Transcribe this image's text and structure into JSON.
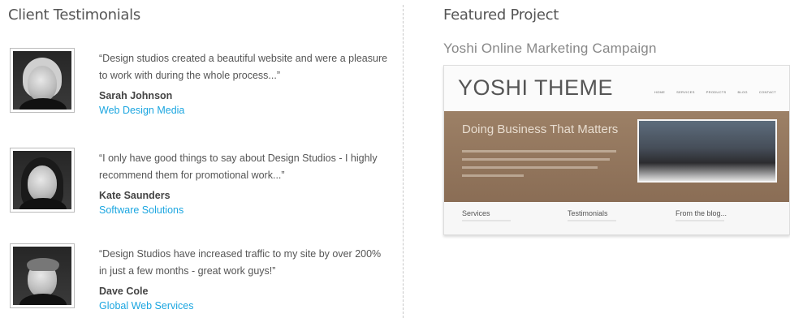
{
  "testimonials": {
    "title": "Client Testimonials",
    "items": [
      {
        "quote": "“Design studios created a beautiful website and were a pleasure to work with during the whole process...”",
        "author": "Sarah Johnson",
        "company": "Web Design Media"
      },
      {
        "quote": "“I only have good things to say about Design Studios - I highly recommend them for promotional work...”",
        "author": "Kate Saunders",
        "company": "Software Solutions"
      },
      {
        "quote": "“Design Studios have increased traffic to my site by over 200% in just a few months - great work guys!”",
        "author": "Dave Cole",
        "company": "Global Web Services"
      }
    ]
  },
  "featured": {
    "title": "Featured Project",
    "project_name": "Yoshi Online Marketing Campaign",
    "mockup": {
      "logo": "YOSHI THEME",
      "nav": [
        "HOME",
        "SERVICES",
        "PRODUCTS",
        "BLOG",
        "CONTACT"
      ],
      "hero_title": "Doing Business That Matters",
      "footer_columns": [
        "Services",
        "Testimonials",
        "From the blog..."
      ]
    }
  },
  "colors": {
    "link": "#1ca6e0",
    "text": "#555555",
    "hero": "#9c8066"
  }
}
